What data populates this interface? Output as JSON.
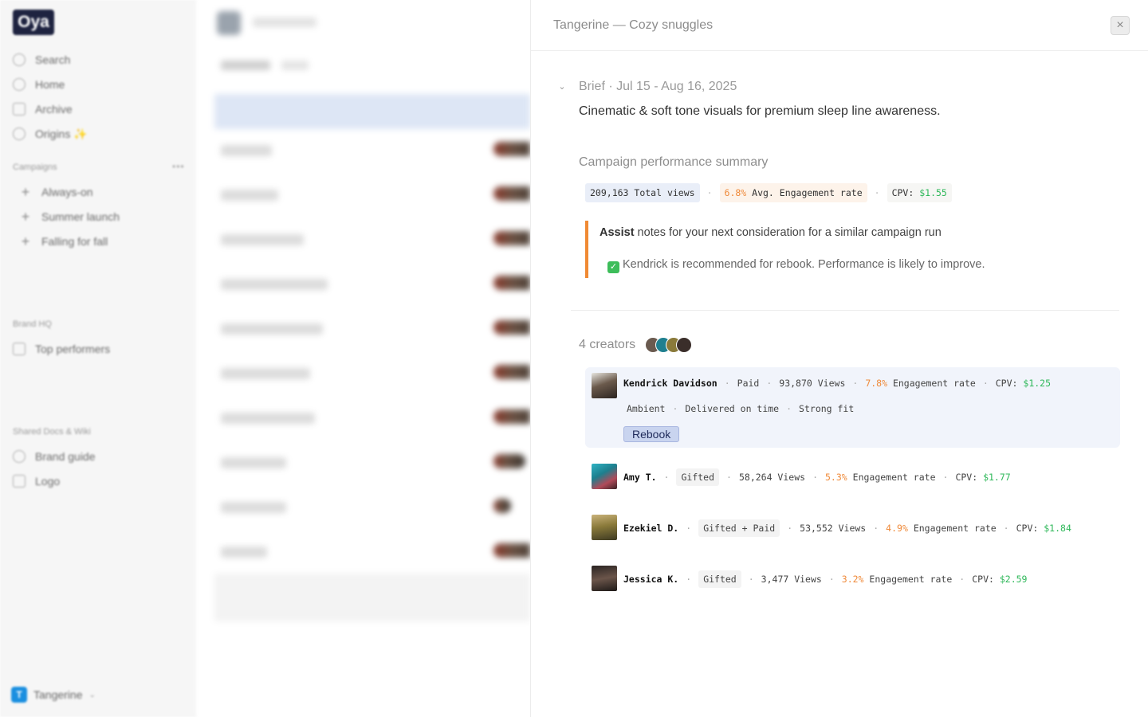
{
  "app": {
    "logo": "Oya"
  },
  "sidebar": {
    "nav": [
      {
        "label": "Search",
        "icon": "search-icon"
      },
      {
        "label": "Home",
        "icon": "home-icon"
      },
      {
        "label": "Archive",
        "icon": "archive-icon"
      },
      {
        "label": "Origins ✨",
        "icon": "origins-icon"
      }
    ],
    "campaigns_label": "Campaigns",
    "campaigns": [
      {
        "label": "Always-on"
      },
      {
        "label": "Summer launch"
      },
      {
        "label": "Falling for fall"
      }
    ],
    "brand_hq_label": "Brand HQ",
    "brand_hq": [
      {
        "label": "Top performers"
      }
    ],
    "docs_label": "Shared Docs & Wiki",
    "docs": [
      {
        "label": "Brand guide"
      },
      {
        "label": "Logo"
      }
    ],
    "workspace": {
      "badge": "T",
      "name": "Tangerine"
    }
  },
  "panel": {
    "title": "Tangerine — Cozy snuggles",
    "close_icon": "close-icon",
    "brief": {
      "label": "Brief · Jul 15 - Aug 16, 2025",
      "description": "Cinematic & soft tone visuals for premium sleep line awareness."
    },
    "performance": {
      "title": "Campaign performance summary",
      "total_views": "209,163",
      "total_views_label": "Total views",
      "engagement": "6.8%",
      "engagement_label": "Avg. Engagement rate",
      "cpv_label": "CPV:",
      "cpv": "$1.55"
    },
    "assist": {
      "bold": "Assist",
      "text": " notes for your next consideration for a similar campaign run",
      "recommendation": "Kendrick is recommended for rebook. Performance is likely to improve."
    },
    "creators_label": "4 creators",
    "creators": [
      {
        "name": "Kendrick Davidson",
        "type": "Paid",
        "views": "93,870 Views",
        "engagement": "7.8%",
        "engagement_label": "Engagement rate",
        "cpv_label": "CPV:",
        "cpv": "$1.25",
        "tags": [
          "Ambient",
          "Delivered on time",
          "Strong fit"
        ],
        "action": "Rebook"
      },
      {
        "name": "Amy T.",
        "type": "Gifted",
        "views": "58,264 Views",
        "engagement": "5.3%",
        "engagement_label": "Engagement rate",
        "cpv_label": "CPV:",
        "cpv": "$1.77"
      },
      {
        "name": "Ezekiel D.",
        "type": "Gifted + Paid",
        "views": "53,552 Views",
        "engagement": "4.9%",
        "engagement_label": "Engagement rate",
        "cpv_label": "CPV:",
        "cpv": "$1.84"
      },
      {
        "name": "Jessica K.",
        "type": "Gifted",
        "views": "3,477 Views",
        "engagement": "3.2%",
        "engagement_label": "Engagement rate",
        "cpv_label": "CPV:",
        "cpv": "$2.59"
      }
    ]
  },
  "colors": {
    "accent_orange": "#ef8a3a",
    "positive_green": "#2fb85a",
    "logo_bg": "#1e2340",
    "selected_bg": "#f1f4fb"
  }
}
